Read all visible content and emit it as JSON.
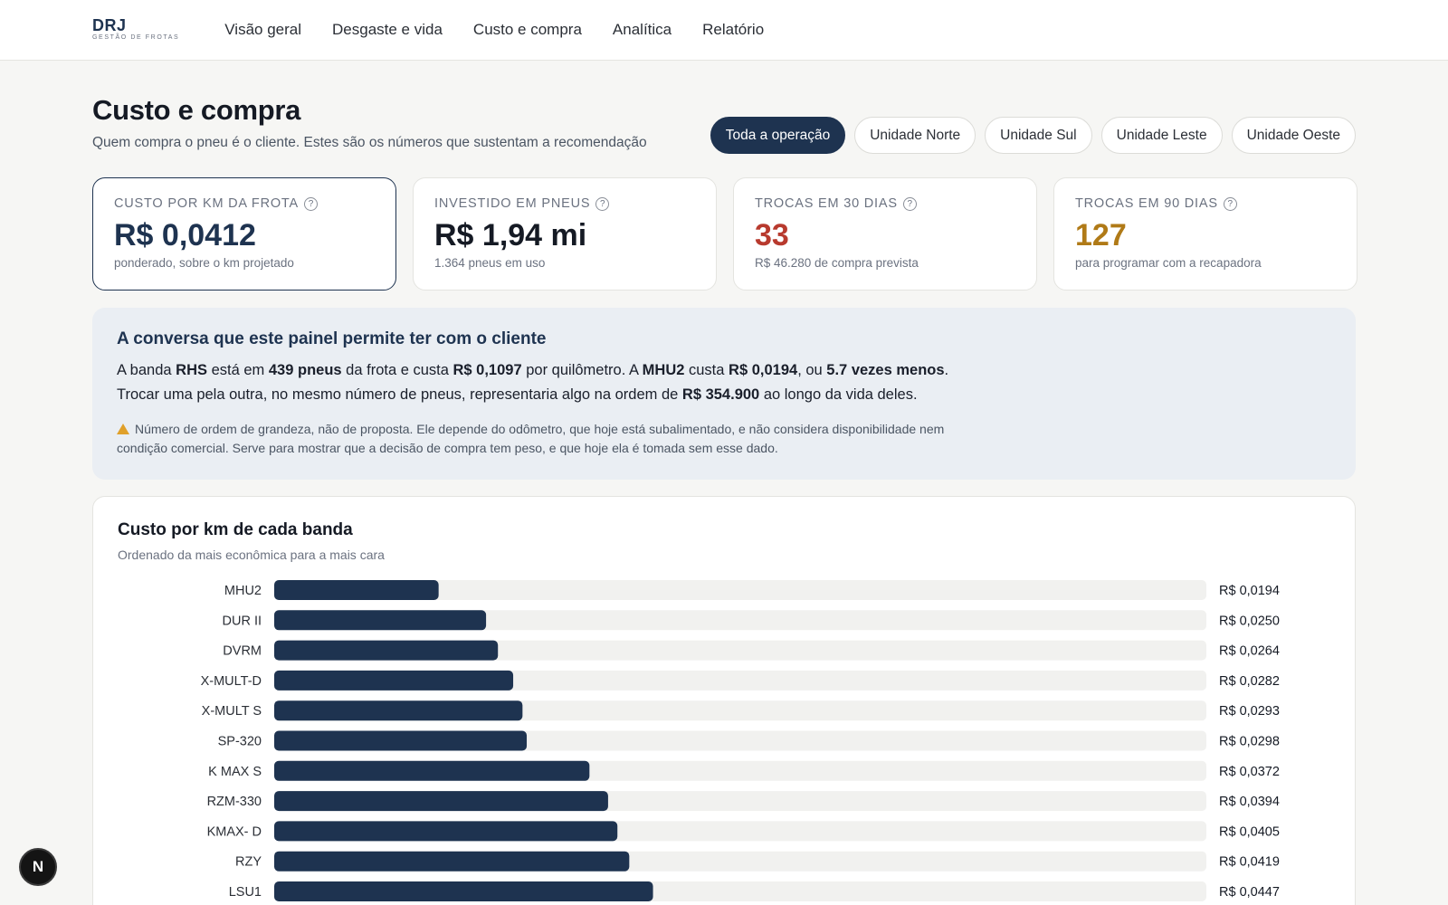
{
  "brand": {
    "name": "DRJ",
    "subtitle": "GESTÃO DE FROTAS"
  },
  "nav": [
    {
      "label": "Visão geral"
    },
    {
      "label": "Desgaste e vida"
    },
    {
      "label": "Custo e compra"
    },
    {
      "label": "Analítica"
    },
    {
      "label": "Relatório"
    }
  ],
  "header": {
    "title": "Custo e compra",
    "subtitle": "Quem compra o pneu é o cliente. Estes são os números que sustentam a recomendação"
  },
  "filters": [
    {
      "label": "Toda a operação",
      "active": true
    },
    {
      "label": "Unidade Norte",
      "active": false
    },
    {
      "label": "Unidade Sul",
      "active": false
    },
    {
      "label": "Unidade Leste",
      "active": false
    },
    {
      "label": "Unidade Oeste",
      "active": false
    }
  ],
  "kpis": [
    {
      "label": "CUSTO POR KM DA FROTA",
      "value": "R$ 0,0412",
      "note": "ponderado, sobre o km projetado",
      "color": "#1e3350"
    },
    {
      "label": "INVESTIDO EM PNEUS",
      "value": "R$ 1,94 mi",
      "note": "1.364 pneus em uso",
      "color": "#151a24"
    },
    {
      "label": "TROCAS EM 30 DIAS",
      "value": "33",
      "note": "R$ 46.280 de compra prevista",
      "color": "#b83a2e"
    },
    {
      "label": "TROCAS EM 90 DIAS",
      "value": "127",
      "note": "para programar com a recapadora",
      "color": "#b07a17"
    }
  ],
  "insight": {
    "title": "A conversa que este painel permite ter com o cliente",
    "line1": [
      {
        "t": "A banda ",
        "b": false
      },
      {
        "t": "RHS",
        "b": true
      },
      {
        "t": " está em ",
        "b": false
      },
      {
        "t": "439 pneus",
        "b": true
      },
      {
        "t": " da frota e custa ",
        "b": false
      },
      {
        "t": "R$ 0,1097",
        "b": true
      },
      {
        "t": " por quilômetro. A ",
        "b": false
      },
      {
        "t": "MHU2",
        "b": true
      },
      {
        "t": " custa ",
        "b": false
      },
      {
        "t": "R$ 0,0194",
        "b": true
      },
      {
        "t": ", ou ",
        "b": false
      },
      {
        "t": "5.7 vezes menos",
        "b": true
      },
      {
        "t": ".",
        "b": false
      }
    ],
    "line2": [
      {
        "t": "Trocar uma pela outra, no mesmo número de pneus, representaria algo na ordem de ",
        "b": false
      },
      {
        "t": "R$ 354.900",
        "b": true
      },
      {
        "t": " ao longo da vida deles.",
        "b": false
      }
    ],
    "warning": "Número de ordem de grandeza, não de proposta. Ele depende do odômetro, que hoje está subalimentado, e não considera disponibilidade nem condição comercial. Serve para mostrar que a decisão de compra tem peso, e que hoje ela é tomada sem esse dado."
  },
  "chart_data": {
    "type": "bar",
    "orientation": "horizontal",
    "title": "Custo por km de cada banda",
    "subtitle": "Ordenado da mais econômica para a mais cara",
    "categories": [
      "MHU2",
      "DUR II",
      "DVRM",
      "X-MULT-D",
      "X-MULT S",
      "SP-320",
      "K MAX S",
      "RZM-330",
      "KMAX- D",
      "RZY",
      "LSU1"
    ],
    "values": [
      0.0194,
      0.025,
      0.0264,
      0.0282,
      0.0293,
      0.0298,
      0.0372,
      0.0394,
      0.0405,
      0.0419,
      0.0447
    ],
    "value_labels": [
      "R$ 0,0194",
      "R$ 0,0250",
      "R$ 0,0264",
      "R$ 0,0282",
      "R$ 0,0293",
      "R$ 0,0298",
      "R$ 0,0372",
      "R$ 0,0394",
      "R$ 0,0405",
      "R$ 0,0419",
      "R$ 0,0447"
    ],
    "xlim": [
      0,
      0.11
    ],
    "bar_color": "#1e3350",
    "track_color": "#f1f1ef"
  },
  "fab": {
    "label": "N"
  }
}
